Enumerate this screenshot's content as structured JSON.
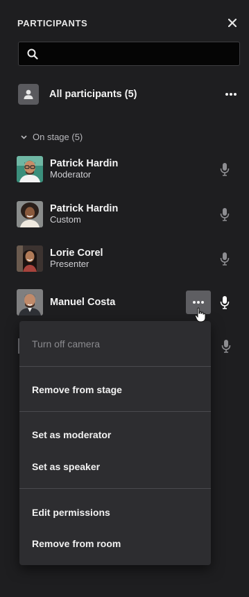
{
  "panel": {
    "title": "PARTICIPANTS",
    "close_icon": "close-icon"
  },
  "search": {
    "value": "",
    "placeholder": ""
  },
  "all_participants": {
    "label": "All participants (5)"
  },
  "section": {
    "label": "On stage (5)"
  },
  "participants": [
    {
      "name": "Patrick Hardin",
      "role": "Moderator"
    },
    {
      "name": "Patrick Hardin",
      "role": "Custom"
    },
    {
      "name": "Lorie Corel",
      "role": "Presenter"
    },
    {
      "name": "Manuel Costa",
      "role": ""
    }
  ],
  "menu": {
    "items": [
      {
        "label": "Turn off camera",
        "disabled": true
      },
      {
        "label": "Remove from stage"
      },
      {
        "label": "Set as moderator"
      },
      {
        "label": "Set as speaker"
      },
      {
        "label": "Edit permissions"
      },
      {
        "label": "Remove from room"
      }
    ]
  },
  "colors": {
    "panel_bg": "#1e1e20",
    "menu_bg": "#2d2d30",
    "active_button": "#5e5e62",
    "mic_active": "#ffffff",
    "mic_muted": "#8d8d91"
  }
}
